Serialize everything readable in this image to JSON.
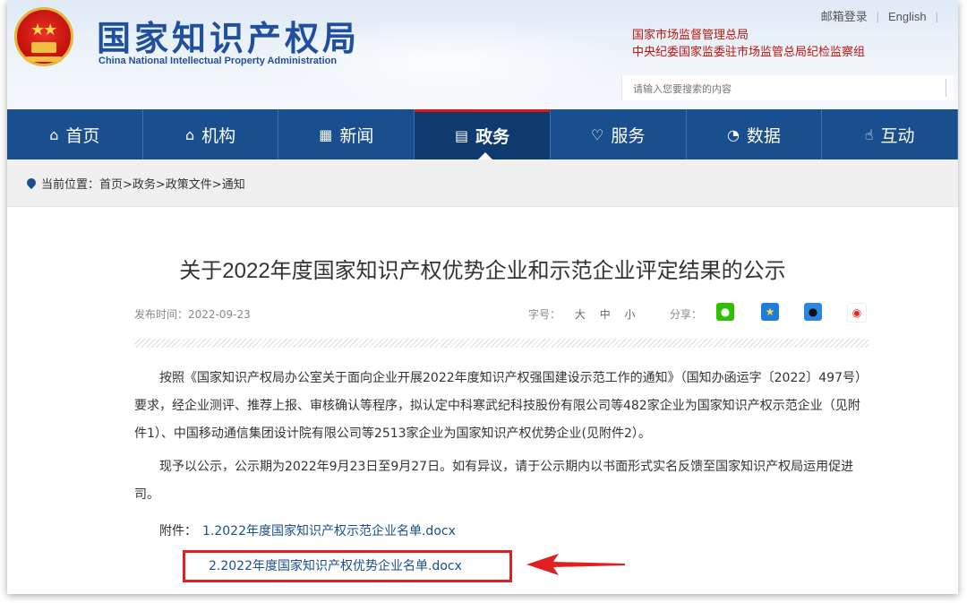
{
  "header": {
    "site_title_cn": "国家知识产权局",
    "site_title_en": "China National Intellectual Property Administration",
    "top_links": [
      "邮箱登录",
      "English"
    ],
    "org_links": [
      "国家市场监督管理总局",
      "中央纪委国家监委驻市场监管总局纪检监察组"
    ],
    "search_placeholder": "请输入您要搜索的内容"
  },
  "nav": {
    "items": [
      {
        "label": "首页",
        "icon": "home-icon",
        "glyph": "⌂"
      },
      {
        "label": "机构",
        "icon": "institution-icon",
        "glyph": "⌂"
      },
      {
        "label": "新闻",
        "icon": "news-icon",
        "glyph": "▦"
      },
      {
        "label": "政务",
        "icon": "document-icon",
        "glyph": "▤",
        "active": true
      },
      {
        "label": "服务",
        "icon": "heart-icon",
        "glyph": "♡"
      },
      {
        "label": "数据",
        "icon": "pie-chart-icon",
        "glyph": "◔"
      },
      {
        "label": "互动",
        "icon": "hand-icon",
        "glyph": "☝"
      }
    ]
  },
  "breadcrumb": {
    "prefix": "当前位置：",
    "path": "首页>政务>政策文件>通知"
  },
  "article": {
    "title": "关于2022年度国家知识产权优势企业和示范企业评定结果的公示",
    "date_label": "发布时间：",
    "date": "2022-09-23",
    "font_size_label": "字号：",
    "font_sizes": [
      "大",
      "中",
      "小"
    ],
    "share_label": "分享：",
    "share_icons": [
      "wechat-icon",
      "qzone-icon",
      "qq-icon",
      "weibo-icon"
    ],
    "paragraph1": "按照《国家知识产权局办公室关于面向企业开展2022年度知识产权强国建设示范工作的通知》（国知办函运字〔2022〕497号）要求，经企业测评、推荐上报、审核确认等程序，拟认定中科寒武纪科技股份有限公司等482家企业为国家知识产权示范企业（见附件1）、中国移动通信集团设计院有限公司等2513家企业为国家知识产权优势企业(见附件2）。",
    "paragraph2": "现予以公示，公示期为2022年9月23日至9月27日。如有异议，请于公示期内以书面形式实名反馈至国家知识产权局运用促进司。",
    "attachments_label": "附件：",
    "attachments": [
      "1.2022年度国家知识产权示范企业名单.docx",
      "2.2022年度国家知识产权优势企业名单.docx"
    ]
  },
  "colors": {
    "nav_bg": "#1a4f8f",
    "accent_red": "#e02020",
    "link_blue": "#1a4f8f"
  }
}
